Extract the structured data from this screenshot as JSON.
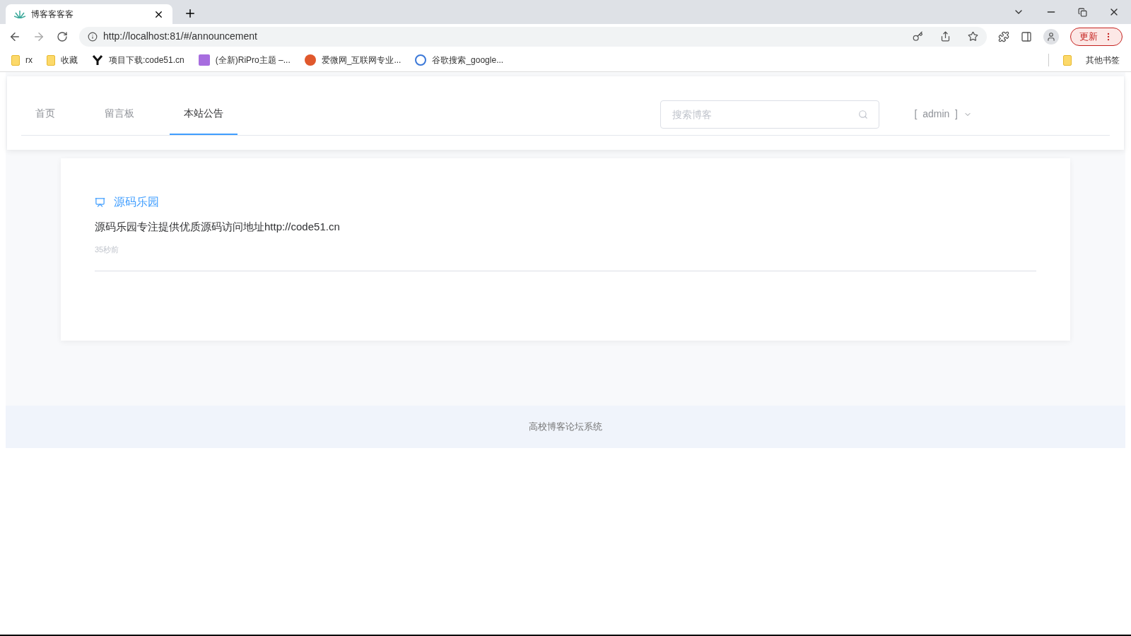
{
  "browser": {
    "tab_title": "博客客客客",
    "url": "http://localhost:81/#/announcement",
    "update_label": "更新",
    "bookmarks": [
      {
        "label": "rx",
        "kind": "folder"
      },
      {
        "label": "收藏",
        "kind": "folder"
      },
      {
        "label": "项目下载:code51.cn",
        "kind": "y"
      },
      {
        "label": "(全新)RiPro主题 –...",
        "kind": "site"
      },
      {
        "label": "爱微网_互联网专业...",
        "kind": "ai"
      },
      {
        "label": "谷歌搜索_google...",
        "kind": "g"
      }
    ],
    "other_bookmarks": "其他书签"
  },
  "nav": {
    "items": [
      {
        "label": "首页",
        "selected": false
      },
      {
        "label": "留言板",
        "selected": false
      },
      {
        "label": "本站公告",
        "selected": true
      }
    ],
    "search": {
      "placeholder": "搜索博客"
    },
    "user": "[  admin  ]"
  },
  "announcements": [
    {
      "title": "源码乐园",
      "content": "源码乐园专注提供优质源码访问地址http://code51.cn",
      "time": "35秒前"
    }
  ],
  "footer": "高校博客论坛系统"
}
